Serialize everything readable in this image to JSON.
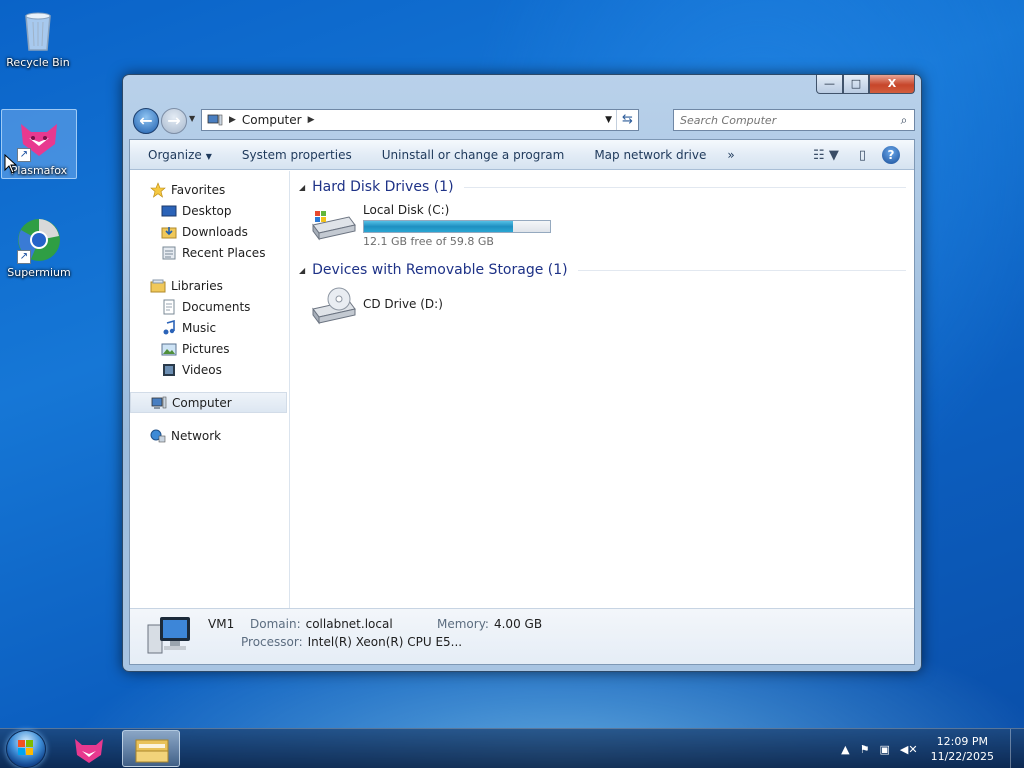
{
  "desktop": {
    "icons": [
      {
        "label": "Recycle Bin",
        "icon": "recycle-bin-icon"
      },
      {
        "label": "Plasmafox",
        "icon": "plasmafox-icon"
      },
      {
        "label": "Supermium",
        "icon": "supermium-icon"
      }
    ]
  },
  "window": {
    "controls": {
      "minimize": "—",
      "maximize": "□",
      "close": "X"
    },
    "address": {
      "crumb": "Computer"
    },
    "search": {
      "placeholder": "Search Computer"
    },
    "toolbar": {
      "organize": "Organize",
      "system_properties": "System properties",
      "uninstall": "Uninstall or change a program",
      "map_drive": "Map network drive",
      "more": "»"
    },
    "nav": {
      "favorites": "Favorites",
      "desktop": "Desktop",
      "downloads": "Downloads",
      "recent_places": "Recent Places",
      "libraries": "Libraries",
      "documents": "Documents",
      "music": "Music",
      "pictures": "Pictures",
      "videos": "Videos",
      "computer": "Computer",
      "network": "Network"
    },
    "groups": {
      "hdd": "Hard Disk Drives (1)",
      "removable": "Devices with Removable Storage (1)"
    },
    "drives": {
      "c": {
        "name": "Local Disk (C:)",
        "free_text": "12.1 GB free of 59.8 GB",
        "used_fraction": 0.8
      },
      "d": {
        "name": "CD Drive (D:)"
      }
    },
    "details": {
      "name": "VM1",
      "domain_label": "Domain:",
      "domain": "collabnet.local",
      "memory_label": "Memory:",
      "memory": "4.00 GB",
      "processor_label": "Processor:",
      "processor": "Intel(R) Xeon(R) CPU E5..."
    }
  },
  "taskbar": {
    "time": "12:09 PM",
    "date": "11/22/2025",
    "tray_arrow": "▲"
  },
  "colors": {
    "accent": "#1e3287",
    "desktop": "#1677d6",
    "drive_fill": "#2aa6d3"
  }
}
